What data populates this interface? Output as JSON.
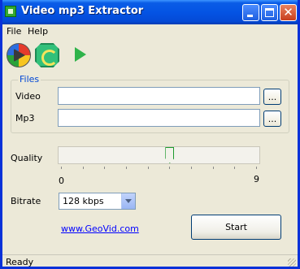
{
  "window": {
    "title": "Video mp3 Extractor",
    "controls": [
      "minimize",
      "maximize",
      "close"
    ]
  },
  "menu": {
    "items": [
      "File",
      "Help"
    ]
  },
  "toolbar": {
    "buttons": [
      {
        "icon": "play-disc-icon"
      },
      {
        "icon": "convert-icon"
      },
      {
        "icon": "go-arrow-icon"
      }
    ]
  },
  "files": {
    "legend": "Files",
    "video_label": "Video",
    "video_value": "",
    "mp3_label": "Mp3",
    "mp3_value": "",
    "browse_label": "..."
  },
  "quality": {
    "label": "Quality",
    "min_label": "0",
    "max_label": "9",
    "min": 0,
    "max": 9,
    "value": 5
  },
  "bitrate": {
    "label": "Bitrate",
    "selected": "128 kbps"
  },
  "link_text": "www.GeoVid.com",
  "start_label": "Start",
  "status_text": "Ready",
  "colors": {
    "titlebar": "#0454e4",
    "window_bg": "#ece9d8",
    "link": "#0000ff",
    "group_legend": "#0046d5"
  }
}
